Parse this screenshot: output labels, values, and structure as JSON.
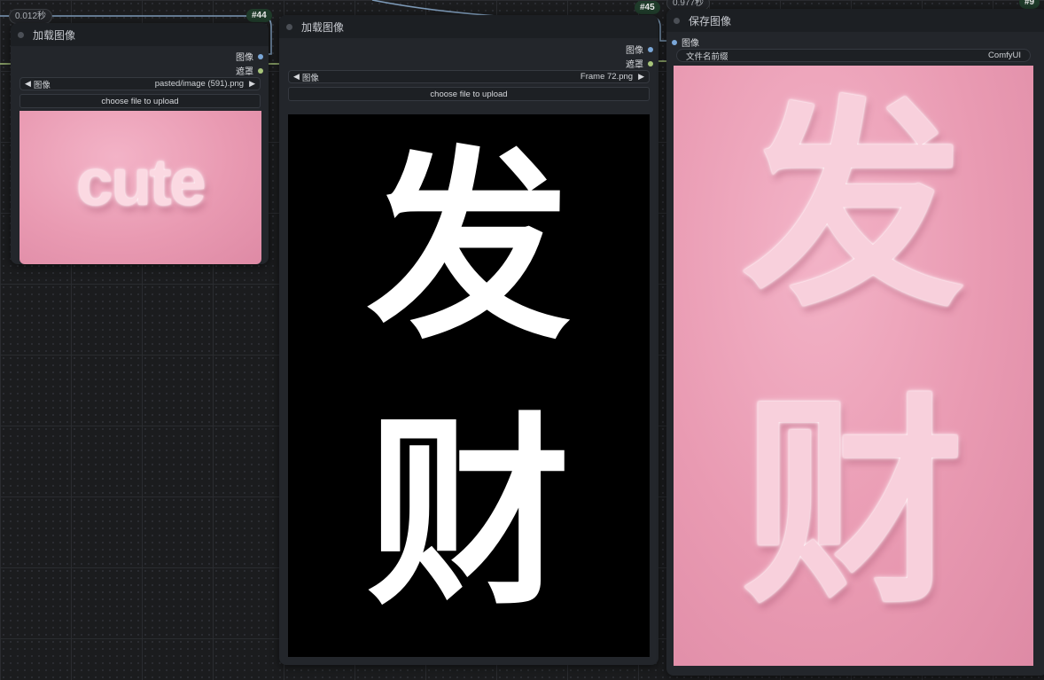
{
  "badges": {
    "left_timing": "0.012秒",
    "left_id": "#44",
    "mid_id": "#45",
    "right_timing": "0.977秒",
    "right_id": "#9"
  },
  "node_left": {
    "title": "加载图像",
    "outputs": [
      "图像",
      "遮罩"
    ],
    "combo_label": "图像",
    "combo_value": "pasted/image (591).png",
    "upload_button": "choose file to upload",
    "preview_text": "cute"
  },
  "node_middle": {
    "title": "加载图像",
    "outputs": [
      "图像",
      "遮罩"
    ],
    "combo_label": "图像",
    "combo_value": "Frame 72.png",
    "upload_button": "choose file to upload",
    "preview_chars": [
      "发",
      "财"
    ]
  },
  "node_right": {
    "title": "保存图像",
    "input": "图像",
    "prefix_label": "文件名前缀",
    "prefix_value": "ComfyUI",
    "preview_chars": [
      "发",
      "财"
    ]
  },
  "colors": {
    "image_socket": "#7aa7d8",
    "mask_socket": "#a7c47a",
    "wire": "#7d9ab8"
  }
}
